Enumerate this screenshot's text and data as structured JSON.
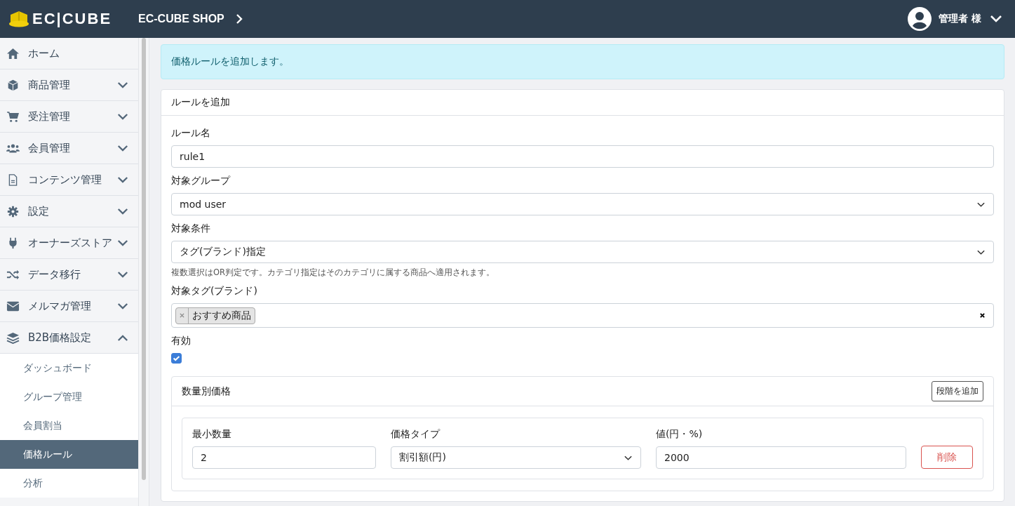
{
  "header": {
    "logo": "EC|CUBE",
    "shop": "EC-CUBE SHOP",
    "user": "管理者 様"
  },
  "sidebar": {
    "items": [
      {
        "label": "ホーム",
        "expandable": false
      },
      {
        "label": "商品管理",
        "expandable": true,
        "expanded": false
      },
      {
        "label": "受注管理",
        "expandable": true,
        "expanded": false
      },
      {
        "label": "会員管理",
        "expandable": true,
        "expanded": false
      },
      {
        "label": "コンテンツ管理",
        "expandable": true,
        "expanded": false
      },
      {
        "label": "設定",
        "expandable": true,
        "expanded": false
      },
      {
        "label": "オーナーズストア",
        "expandable": true,
        "expanded": false
      },
      {
        "label": "データ移行",
        "expandable": true,
        "expanded": false
      },
      {
        "label": "メルマガ管理",
        "expandable": true,
        "expanded": false
      },
      {
        "label": "B2B価格設定",
        "expandable": true,
        "expanded": true,
        "children": [
          {
            "label": "ダッシュボード",
            "selected": false
          },
          {
            "label": "グループ管理",
            "selected": false
          },
          {
            "label": "会員割当",
            "selected": false
          },
          {
            "label": "価格ルール",
            "selected": true
          },
          {
            "label": "分析",
            "selected": false
          }
        ]
      }
    ]
  },
  "alert": "価格ルールを追加します。",
  "card": {
    "title": "ルールを追加",
    "fields": [
      {
        "kind": "text",
        "label": "ルール名",
        "value": "rule1"
      },
      {
        "kind": "select",
        "label": "対象グループ",
        "value": "mod user"
      },
      {
        "kind": "select",
        "label": "対象条件",
        "value": "タグ(ブランド)指定",
        "help": "複数選択はOR判定です。カテゴリ指定はそのカテゴリに属する商品へ適用されます。"
      },
      {
        "kind": "tags",
        "label": "対象タグ(ブランド)",
        "tags": [
          "おすすめ商品"
        ]
      },
      {
        "kind": "checkbox",
        "label": "有効",
        "checked": true
      }
    ],
    "tiers": {
      "title": "数量別価格",
      "add_button": "段階を追加",
      "columns": [
        "最小数量",
        "価格タイプ",
        "値(円・%)"
      ],
      "rows": [
        {
          "min_qty": "2",
          "price_type": "割引額(円)",
          "value": "2000",
          "delete_button": "削除"
        }
      ]
    }
  }
}
